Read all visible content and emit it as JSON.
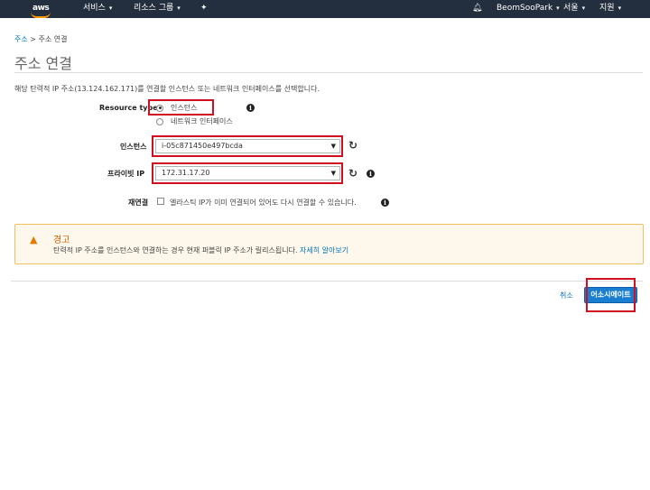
{
  "topbar": {
    "logo": "aws",
    "services": "서비스",
    "resource_groups": "리소스 그룹",
    "user": "BeomSooPark",
    "region": "서울",
    "support": "지원"
  },
  "breadcrumb": {
    "root": "주소",
    "separator": ">",
    "current": "주소 연결"
  },
  "page_title": "주소 연결",
  "description": "해당 탄력적 IP 주소(13.124.162.171)를 연결할 인스턴스 또는 네트워크 인터페이스를 선택합니다.",
  "form": {
    "resource_type_label": "Resource type",
    "resource_options": [
      "인스턴스",
      "네트워크 인터페이스"
    ],
    "selected_resource": "인스턴스",
    "instance_label": "인스턴스",
    "instance_value": "i-05c871450e497bcda",
    "private_ip_label": "프라이빗 IP",
    "private_ip_value": "172.31.17.20",
    "reassoc_label": "재연결",
    "reassoc_text": "엘라스틱 IP가 이미 연결되어 있어도 다시 연결할 수 있습니다."
  },
  "warning": {
    "title": "경고",
    "body": "탄력적 IP 주소를 인스턴스와 연결하는 경우 현재 퍼블릭 IP 주소가 릴리스됩니다.",
    "link": "자세히 알아보기"
  },
  "footer": {
    "cancel": "취소",
    "submit": "어소시에이트"
  },
  "colors": {
    "topbar": "#232f3e",
    "accent": "#f90",
    "primary": "#1a7ed0",
    "highlight": "#d01020"
  },
  "icons": [
    "bell-icon",
    "pin-icon",
    "refresh-icon",
    "info-icon",
    "warning-icon",
    "chevron-down-icon"
  ]
}
